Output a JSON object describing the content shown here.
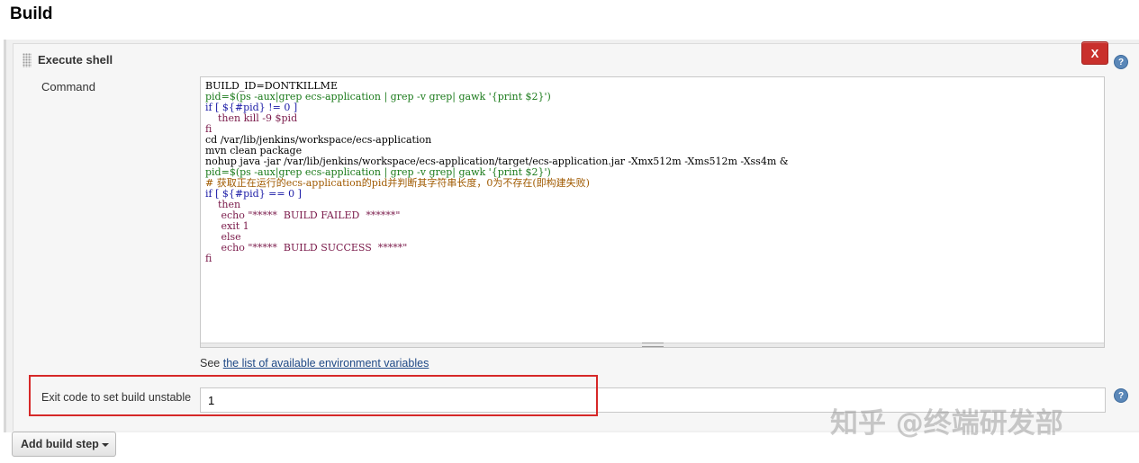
{
  "section": {
    "title": "Build"
  },
  "step": {
    "title": "Execute shell",
    "delete_label": "X",
    "command_label": "Command",
    "command_lines": [
      "BUILD_ID=DONTKILLME",
      "pid=$(ps -aux|grep ecs-application | grep -v grep| gawk '{print $2}')",
      "if [ ${#pid} != 0 ]",
      "    then kill -9 $pid",
      "fi",
      "cd /var/lib/jenkins/workspace/ecs-application",
      "mvn clean package",
      "nohup java -jar /var/lib/jenkins/workspace/ecs-application/target/ecs-application.jar -Xmx512m -Xms512m -Xss4m &",
      "pid=$(ps -aux|grep ecs-application | grep -v grep| gawk '{print $2}')",
      "# 获取正在运行的ecs-application的pid并判断其字符串长度，0为不存在(即构建失败)",
      "if [ ${#pid} == 0 ]",
      "    then",
      "     echo \"*****  BUILD FAILED  ******\"",
      "     exit 1",
      "     else",
      "     echo \"*****  BUILD SUCCESS  *****\"",
      "fi"
    ],
    "see_prefix": "See ",
    "see_link": "the list of available environment variables",
    "exit_code_label": "Exit code to set build unstable",
    "exit_code_value": "1"
  },
  "add_build_step_label": "Add build step",
  "help_icon_symbol": "?",
  "watermark": "知乎 @终端研发部",
  "icons": {
    "help": "help-icon",
    "delete": "close-icon",
    "dropdown": "chevron-down-icon",
    "drag": "drag-handle-icon"
  }
}
